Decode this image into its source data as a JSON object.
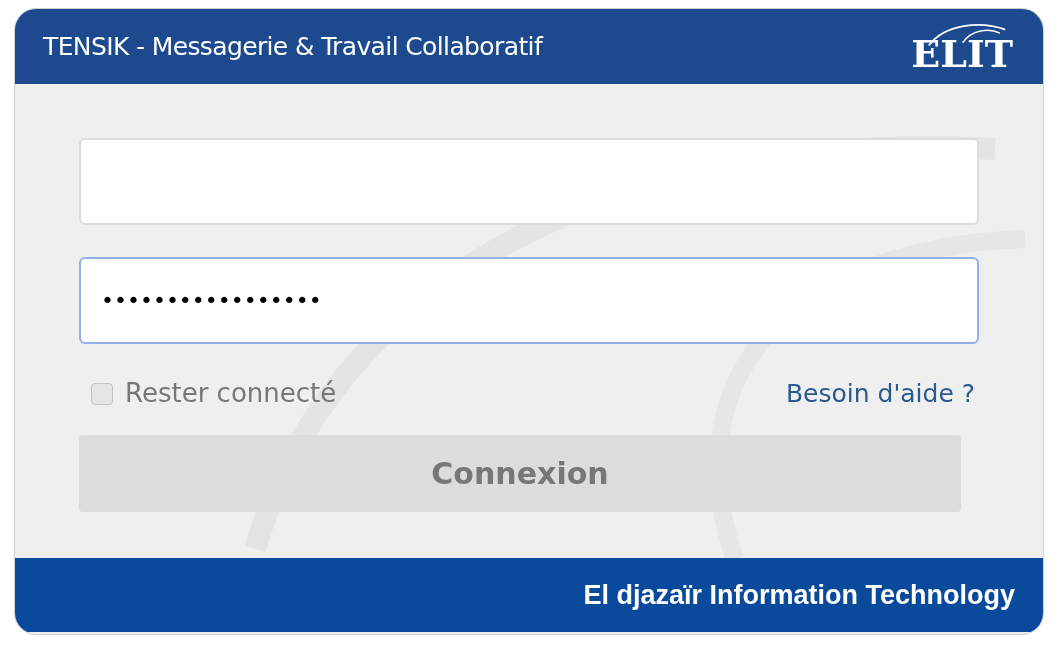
{
  "header": {
    "title": "TENSIK -  Messagerie & Travail Collaboratif",
    "logo": "ELIT"
  },
  "password": {
    "value": "•••••••••••••••••",
    "focused": true
  },
  "remember": {
    "label": "Rester connecté",
    "checked": false
  },
  "help_link": "Besoin d'aide ?",
  "submit": {
    "label": "Connexion",
    "disabled": true
  },
  "footer": "El djazaïr Information Technology"
}
